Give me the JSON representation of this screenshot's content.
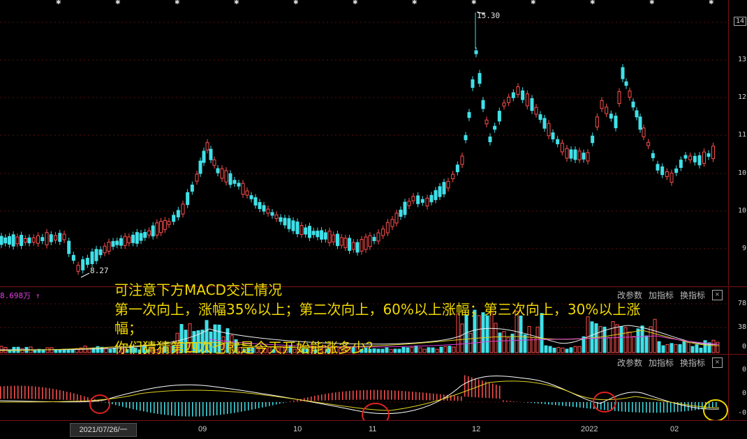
{
  "price_axis": {
    "current": "14",
    "ticks": [
      "14",
      "13",
      "12",
      "11",
      "10",
      "9"
    ]
  },
  "price_markers": {
    "high": "15.30",
    "low": "8.27"
  },
  "volume_panel": {
    "label": "8.698万 ↑",
    "buttons": {
      "params": "改参数",
      "add": "加指标",
      "switch": "换指标",
      "close": "×"
    },
    "ticks": [
      "78",
      "38",
      "0"
    ]
  },
  "macd_panel": {
    "buttons": {
      "params": "改参数",
      "add": "加指标",
      "switch": "换指标",
      "close": "×"
    },
    "ticks": [
      "0",
      "0",
      "-0"
    ]
  },
  "annotation": {
    "line1": "可注意下方MACD交汇情况",
    "line2": "第一次向上，涨幅35%以上；第二次向上，60%以上涨幅；第三次向上，30%以上涨",
    "line3": "幅；",
    "line4": "你们猜猜第四次也就是今天开始能涨多少？"
  },
  "x_axis": {
    "cursor_date": "2021/07/26/一",
    "labels": [
      "09",
      "10",
      "11",
      "12",
      "2022",
      "02"
    ]
  },
  "colors": {
    "up": "#ff4f4f",
    "down": "#40e0e8",
    "highlight_circle": "#e02020",
    "current_circle": "#f0d800",
    "annotation": "#f0d800"
  }
}
